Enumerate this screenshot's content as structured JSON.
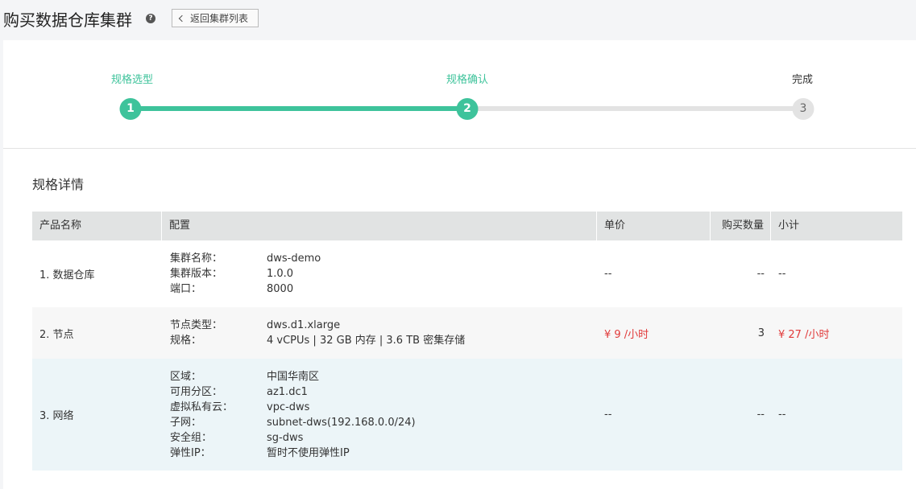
{
  "header": {
    "title": "购买数据仓库集群",
    "help_icon": "?",
    "back_label": "返回集群列表"
  },
  "steps": [
    {
      "label": "规格选型",
      "number": "1",
      "state": "done"
    },
    {
      "label": "规格确认",
      "number": "2",
      "state": "done"
    },
    {
      "label": "完成",
      "number": "3",
      "state": "todo"
    }
  ],
  "section_title": "规格详情",
  "table": {
    "headers": [
      "产品名称",
      "配置",
      "单价",
      "购买数量",
      "小计"
    ],
    "rows": [
      {
        "name": "1. 数据仓库",
        "config": [
          {
            "k": "集群名称：",
            "v": "dws-demo"
          },
          {
            "k": "集群版本：",
            "v": "1.0.0"
          },
          {
            "k": "端口：",
            "v": "8000"
          }
        ],
        "price": "--",
        "qty": "--",
        "subtotal": "--"
      },
      {
        "name": "2. 节点",
        "config": [
          {
            "k": "节点类型：",
            "v": "dws.d1.xlarge"
          },
          {
            "k": "规格：",
            "v": "4 vCPUs | 32 GB 内存 | 3.6 TB 密集存储"
          }
        ],
        "price": "¥ 9 /小时",
        "qty": "3",
        "subtotal": "¥ 27 /小时"
      },
      {
        "name": "3. 网络",
        "config": [
          {
            "k": "区域：",
            "v": "中国华南区"
          },
          {
            "k": "可用分区：",
            "v": "az1.dc1"
          },
          {
            "k": "虚拟私有云：",
            "v": "vpc-dws"
          },
          {
            "k": "子网：",
            "v": "subnet-dws(192.168.0.0/24)"
          },
          {
            "k": "安全组：",
            "v": "sg-dws"
          },
          {
            "k": "弹性IP：",
            "v": "暂时不使用弹性IP"
          }
        ],
        "price": "--",
        "qty": "--",
        "subtotal": "--"
      }
    ]
  },
  "colors": {
    "accent": "#3ec39b",
    "price": "#e13a3a"
  }
}
